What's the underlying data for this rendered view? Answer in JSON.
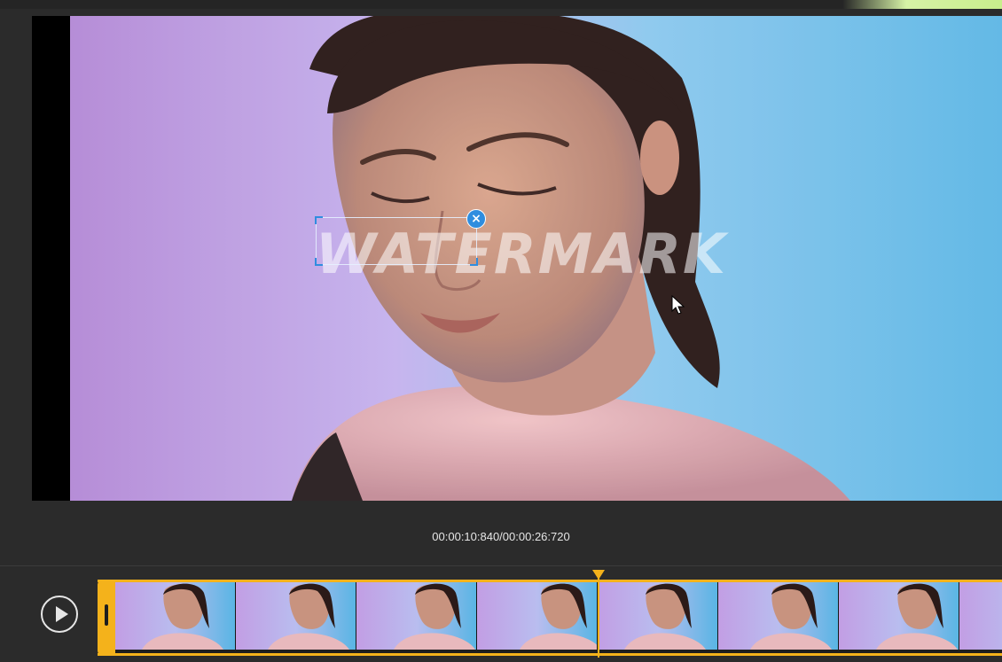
{
  "preview": {
    "watermark_text": "WATERMARK",
    "close_glyph": "×"
  },
  "playback": {
    "timecode": "00:00:10:840/00:00:26:720"
  },
  "timeline": {
    "thumbnail_count": 8,
    "playhead_fraction": 0.408
  },
  "icons": {
    "play": "play-icon",
    "close": "close-icon",
    "cursor": "mouse-cursor-icon"
  },
  "colors": {
    "accent": "#f4b21b",
    "selection": "#2f8ddf",
    "background": "#2b2b2b"
  }
}
